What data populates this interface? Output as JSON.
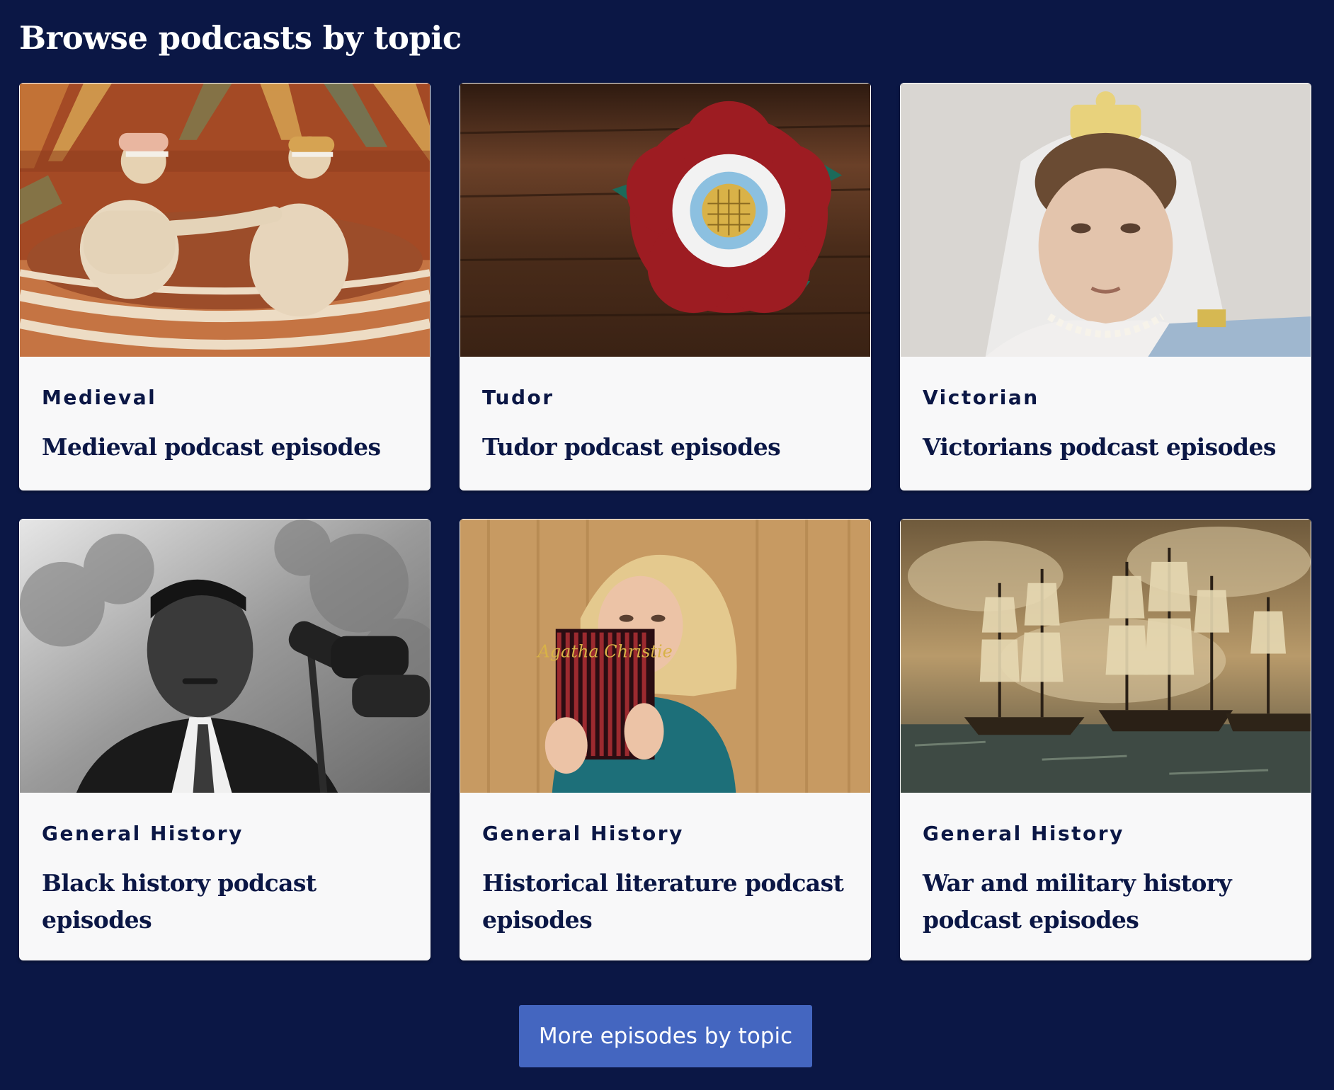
{
  "section": {
    "title": "Browse podcasts by topic"
  },
  "cards": [
    {
      "category": "Medieval",
      "title": "Medieval podcast episodes",
      "image": "medieval-bath-fresco-image"
    },
    {
      "category": "Tudor",
      "title": "Tudor podcast episodes",
      "image": "tudor-rose-image"
    },
    {
      "category": "Victorian",
      "title": "Victorians podcast episodes",
      "image": "queen-victoria-portrait-image"
    },
    {
      "category": "General History",
      "title": "Black history podcast episodes",
      "image": "civil-rights-speaker-image"
    },
    {
      "category": "General History",
      "title": "Historical literature podcast episodes",
      "image": "woman-with-agatha-christie-book-image",
      "book_text": "Agatha Christie"
    },
    {
      "category": "General History",
      "title": "War and military history podcast episodes",
      "image": "naval-battle-painting-image"
    }
  ],
  "more_button": {
    "label": "More episodes by topic"
  },
  "colors": {
    "background": "#0b1745",
    "card": "#f8f8f9",
    "text": "#0b1745",
    "button": "#4466c0"
  }
}
